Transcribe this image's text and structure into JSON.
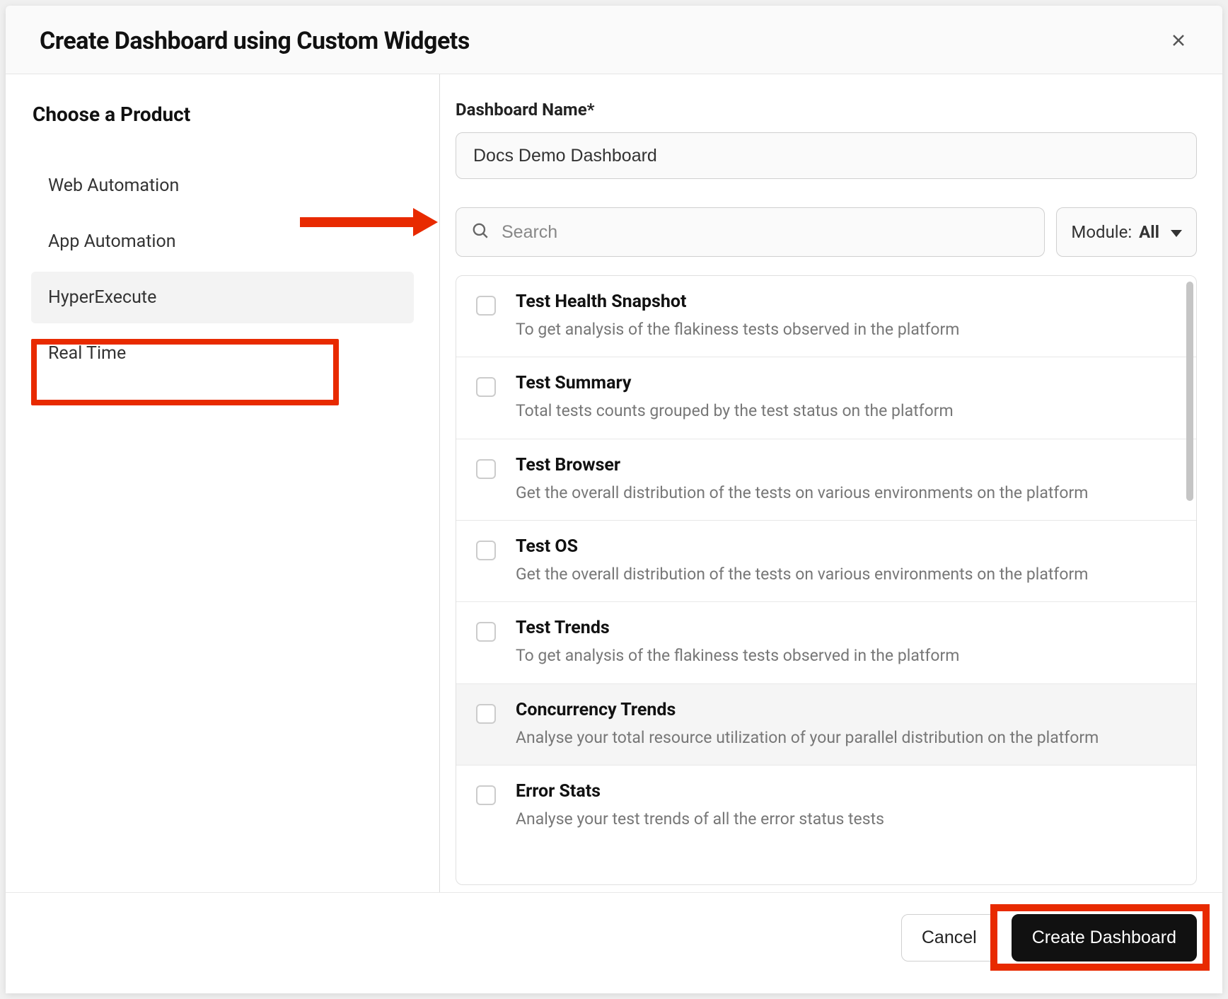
{
  "modal": {
    "title": "Create Dashboard using Custom Widgets"
  },
  "sidebar": {
    "title": "Choose a Product",
    "items": [
      {
        "label": "Web Automation",
        "selected": false
      },
      {
        "label": "App Automation",
        "selected": false
      },
      {
        "label": "HyperExecute",
        "selected": true
      },
      {
        "label": "Real Time",
        "selected": false
      }
    ]
  },
  "main": {
    "name_label": "Dashboard Name*",
    "name_value": "Docs Demo Dashboard",
    "search_placeholder": "Search",
    "module_label": "Module:",
    "module_value": "All",
    "widgets": [
      {
        "title": "Test Health Snapshot",
        "desc": "To get analysis of the flakiness tests observed in the platform",
        "highlighted": false
      },
      {
        "title": "Test Summary",
        "desc": "Total tests counts grouped by the test status on the platform",
        "highlighted": false
      },
      {
        "title": "Test Browser",
        "desc": "Get the overall distribution of the tests on various environments on the platform",
        "highlighted": false
      },
      {
        "title": "Test OS",
        "desc": "Get the overall distribution of the tests on various environments on the platform",
        "highlighted": false
      },
      {
        "title": "Test Trends",
        "desc": "To get analysis of the flakiness tests observed in the platform",
        "highlighted": false
      },
      {
        "title": "Concurrency Trends",
        "desc": "Analyse your total resource utilization of your parallel distribution on the platform",
        "highlighted": true
      },
      {
        "title": "Error Stats",
        "desc": "Analyse your test trends of all the error status tests",
        "highlighted": false
      }
    ]
  },
  "footer": {
    "cancel": "Cancel",
    "create": "Create Dashboard"
  },
  "annotations": {
    "highlight_color": "#e82a00"
  }
}
